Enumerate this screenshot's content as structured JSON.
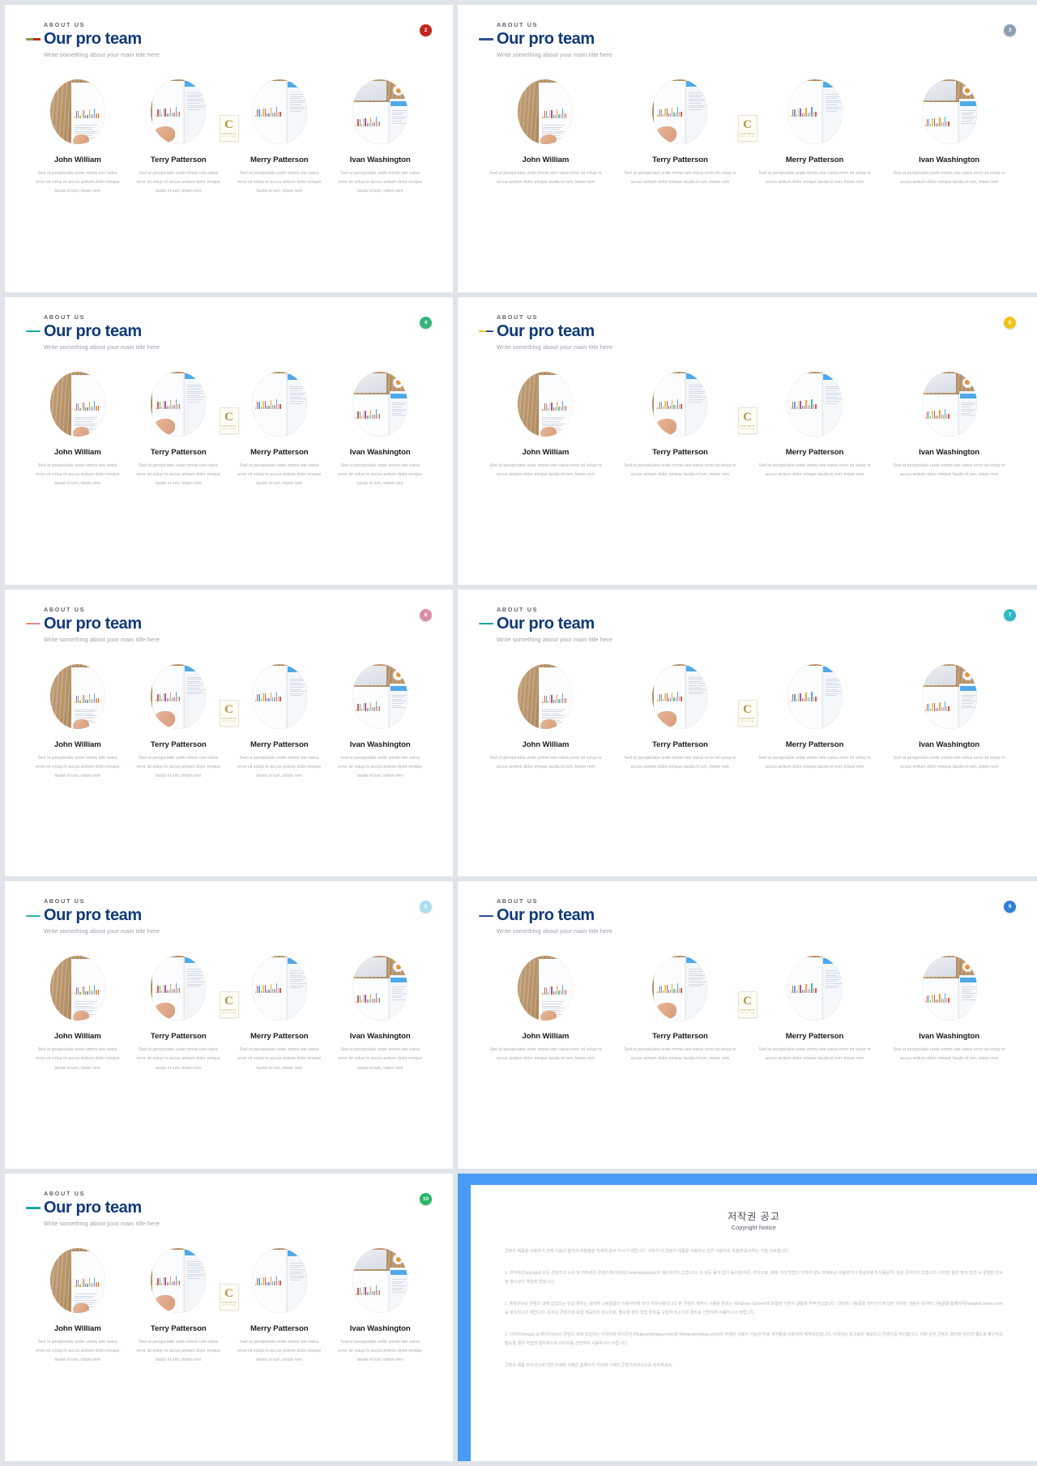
{
  "deck": {
    "member_name_1": "John William",
    "member_name_2": "Terry Patterson",
    "member_name_3": "Merry Patterson",
    "member_name_4": "Ivan Washington",
    "member_desc": "Sed ut perspiciatis unde omnis iste natus error sit volup m accus antium dolor emque lauda nt ium, totam rem",
    "kicker": "ABOUT US",
    "title": "Our pro team",
    "subtitle": "Write something about your main title here",
    "card_letter": "C",
    "card_text_1": "CONTENTS",
    "card_text_2": "PROTO PLAN"
  },
  "slides": [
    {
      "badge": "2",
      "badge_color": "#c0261f",
      "accent_1": "#7e9b46",
      "accent_2": "#c0261f"
    },
    {
      "badge": "3",
      "badge_color": "#8d9fb5",
      "accent_1": "#2f4f8f",
      "accent_2": "#2f4f8f"
    },
    {
      "badge": "4",
      "badge_color": "#34b37d",
      "accent_1": "#18a5a0",
      "accent_2": "#18a5a0"
    },
    {
      "badge": "5",
      "badge_color": "#f0c419",
      "accent_1": "#f0c419",
      "accent_2": "#2f4f8f"
    },
    {
      "badge": "6",
      "badge_color": "#d98fa8",
      "accent_1": "#ef8a5c",
      "accent_2": "#d98fa8"
    },
    {
      "badge": "7",
      "badge_color": "#2fb8c6",
      "accent_1": "#18a5a0",
      "accent_2": "#18a5a0"
    },
    {
      "badge": "8",
      "badge_color": "#a8dff0",
      "accent_1": "#2fb8a0",
      "accent_2": "#2fb8a0"
    },
    {
      "badge": "9",
      "badge_color": "#2f7fd8",
      "accent_1": "#2f4f8f",
      "accent_2": "#2f4f8f"
    },
    {
      "badge": "10",
      "badge_color": "#27b567",
      "accent_1": "#18a5a0",
      "accent_2": "#18a5a0"
    }
  ],
  "copyright": {
    "title": "저작권 공고",
    "subtitle": "Copyright Notice",
    "paragraphs": [
      "콘텐츠 제품을 사용하기 전에 다음의 협약과 조항들을 자세히 읽어 주시기 바랍니다. 귀하가 이 콘텐츠 제품을 사용하는 것은 사용허락 조항에 동의하는 것을 의미합니다.",
      "1. 저작권(Copyright) 모든 콘텐츠의 소유 및 저작권은 콘텐츠레이아웃(Contentslayouts)의 재산이자이 있습니다. 이 모든 용어 없이 동의에 따른, 무단으로, 배포 기타 방법의 의하여 양도 무제로손 이용하거나 재상자에게 이용금지. 권은 금지되어 있습니다. 이러한 물건 명의 발견 시 문명한 인사 및 형사상의 책임을 받습니다.",
      "2. 폰트(Font) 콘텐츠 내에 삽입되는 한글 폰트는 네이버 나눔글꼴의 이용약관에 따라 자유이용되니다 본 콘텐츠 제작시 사용된 폰트는 Windows System에 포함된 기본의 글꼴로 저작권있습니다. 네이버 나눔글꼴 라이선스에 대한 자세한 내용은 네이버 나눔글꼴 홈페이지(hangeul.naver.com)를 참조하시기 바랍니다. 폰트는 콘텐츠에 포함 제공되지 않으므로, 필요할 경우 직접 폰트를 구입하거나 다른 폰트로 선명하여 사용하시기 바랍니다.",
      "3. 이미지(Image) & 데이터(Icon) 콘텐츠 내에 삽입되는 이미지와 아이콘은 Pixabay(pixabay.com)와 Webandi(webaly.com)의 무제한 사용이 가능한 무료 저작물을 이용하여 제작되었습니다. 이미지는 참고로만 제공되고 콘텐츠를 무단합니다. 이에 관한 콘텐츠 권리와 권한의 별도로 확인하고 필요할 경우 적법한 절차적으로 이미지를 선명하여 사용하시기 바랍니다.",
      "콘텐츠 제품 라이선스에 대한 자세한 사항은 홈페이지 하단에 기재한 콘텐츠라이선스를 참조하세요."
    ]
  }
}
